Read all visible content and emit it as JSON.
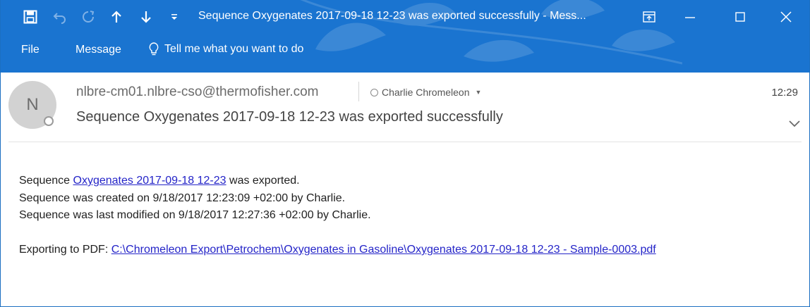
{
  "titlebar": {
    "title": "Sequence Oxygenates 2017-09-18 12-23 was exported successfully  -  Mess..."
  },
  "menu": {
    "file": "File",
    "message": "Message",
    "tellme": "Tell me what you want to do"
  },
  "header": {
    "avatar_initial": "N",
    "sender": "nlbre-cm01.nlbre-cso@thermofisher.com",
    "recipient": "Charlie Chromeleon",
    "time": "12:29",
    "subject": "Sequence Oxygenates 2017-09-18 12-23 was exported successfully"
  },
  "body": {
    "line1_prefix": "Sequence ",
    "line1_link": "Oxygenates 2017-09-18 12-23",
    "line1_suffix": " was exported.",
    "line2": "Sequence was created on 9/18/2017 12:23:09 +02:00 by Charlie.",
    "line3": "Sequence was last modified on 9/18/2017 12:27:36 +02:00 by Charlie.",
    "line4_prefix": "Exporting to PDF: ",
    "line4_link": "C:\\Chromeleon  Export\\Petrochem\\Oxygenates in Gasoline\\Oxygenates 2017-09-18 12-23 - Sample-0003.pdf"
  },
  "colors": {
    "titlebar": "#1a74d0",
    "link": "#2424c8"
  },
  "icons": [
    "save-icon",
    "undo-icon",
    "redo-icon",
    "previous-item-icon",
    "next-item-icon",
    "customize-quick-access-icon",
    "ribbon-display-options-icon",
    "minimize-icon",
    "maximize-icon",
    "close-icon",
    "lightbulb-icon",
    "presence-icon",
    "expand-header-icon"
  ]
}
